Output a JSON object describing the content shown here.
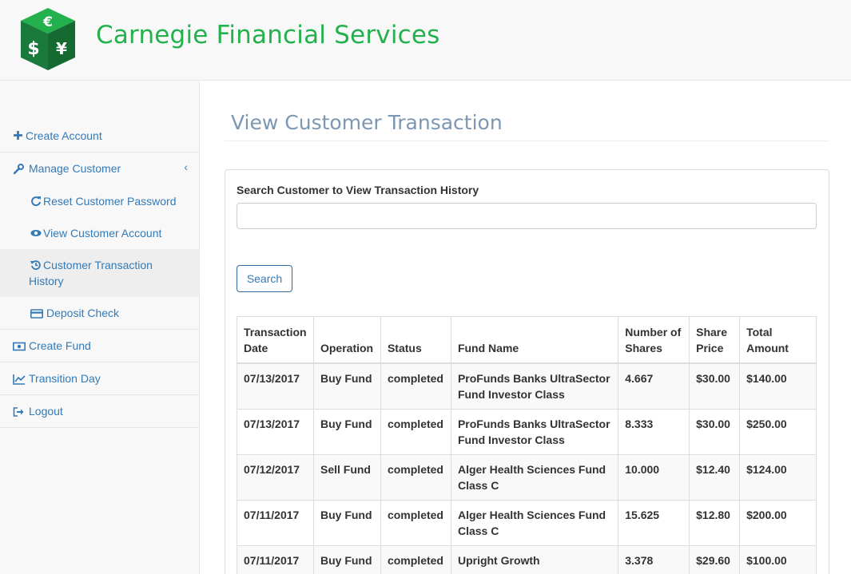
{
  "header": {
    "brand": "Carnegie Financial Services",
    "logo_colors": {
      "face_front": "#1a7a3c",
      "face_side": "#156a32",
      "face_top": "#23b14d",
      "glyph": "#ffffff"
    },
    "logo_glyphs": [
      "€",
      "$",
      "¥"
    ]
  },
  "sidebar": {
    "items": [
      {
        "label": "Create Account",
        "icon": "plus-icon"
      },
      {
        "label": "Manage Customer",
        "icon": "wrench-icon",
        "expanded": true
      },
      {
        "label": "Reset Customer Password",
        "icon": "refresh-icon"
      },
      {
        "label": "View Customer Account",
        "icon": "eye-icon"
      },
      {
        "label_line1": "Customer Transaction",
        "label_line2": "History",
        "icon": "history-icon",
        "active": true
      },
      {
        "label": "Deposit Check",
        "icon": "credit-card-icon"
      },
      {
        "label": "Create Fund",
        "icon": "money-icon"
      },
      {
        "label": "Transition Day",
        "icon": "line-chart-icon"
      },
      {
        "label": "Logout",
        "icon": "sign-out-icon"
      }
    ],
    "expand_glyph": "‹"
  },
  "main": {
    "title": "View Customer Transaction",
    "search": {
      "label": "Search Customer to View Transaction History",
      "value": "",
      "placeholder": "",
      "button": "Search"
    },
    "table": {
      "headers": [
        {
          "l1": "Transaction",
          "l2": "Date"
        },
        {
          "l1": "",
          "l2": "Operation"
        },
        {
          "l1": "",
          "l2": "Status"
        },
        {
          "l1": "",
          "l2": "Fund Name"
        },
        {
          "l1": "Number of",
          "l2": "Shares"
        },
        {
          "l1": "Share",
          "l2": "Price"
        },
        {
          "l1": "Total",
          "l2": "Amount"
        }
      ],
      "rows": [
        {
          "date": "07/13/2017",
          "operation": "Buy Fund",
          "status": "completed",
          "fund_l1": "ProFunds Banks UltraSector",
          "fund_l2": "Fund Investor Class",
          "shares": "4.667",
          "price": "$30.00",
          "total": "$140.00"
        },
        {
          "date": "07/13/2017",
          "operation": "Buy Fund",
          "status": "completed",
          "fund_l1": "ProFunds Banks UltraSector",
          "fund_l2": "Fund Investor Class",
          "shares": "8.333",
          "price": "$30.00",
          "total": "$250.00"
        },
        {
          "date": "07/12/2017",
          "operation": "Sell Fund",
          "status": "completed",
          "fund_l1": "Alger Health Sciences Fund",
          "fund_l2": "Class C",
          "shares": "10.000",
          "price": "$12.40",
          "total": "$124.00"
        },
        {
          "date": "07/11/2017",
          "operation": "Buy Fund",
          "status": "completed",
          "fund_l1": "Alger Health Sciences Fund",
          "fund_l2": "Class C",
          "shares": "15.625",
          "price": "$12.80",
          "total": "$200.00"
        },
        {
          "date": "07/11/2017",
          "operation": "Buy Fund",
          "status": "completed",
          "fund_l1": "Upright Growth",
          "fund_l2": "",
          "shares": "3.378",
          "price": "$29.60",
          "total": "$100.00"
        }
      ]
    }
  },
  "colors": {
    "brand": "#23b14d",
    "link": "#337ab7",
    "title": "#7c97b2",
    "sidebar_bg": "#f8f8f8",
    "active_bg": "#eeeeee"
  }
}
